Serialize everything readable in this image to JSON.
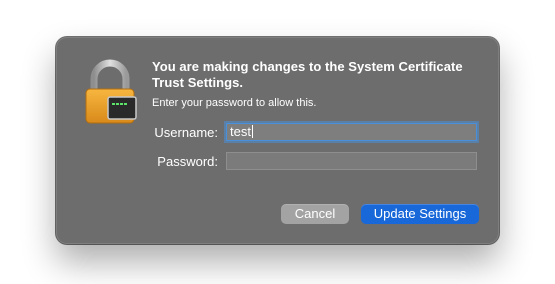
{
  "dialog": {
    "title": "You are making changes to the System Certificate Trust Settings.",
    "subtitle": "Enter your password to allow this.",
    "icon": "lock-icon",
    "username_label": "Username:",
    "username_value": "test",
    "password_label": "Password:",
    "password_value": "",
    "cancel_label": "Cancel",
    "confirm_label": "Update Settings"
  },
  "colors": {
    "dialog_bg": "#6d6d6d",
    "accent": "#1868d9",
    "lock_body": "#f0a830",
    "focus_ring": "#4a90d9"
  }
}
